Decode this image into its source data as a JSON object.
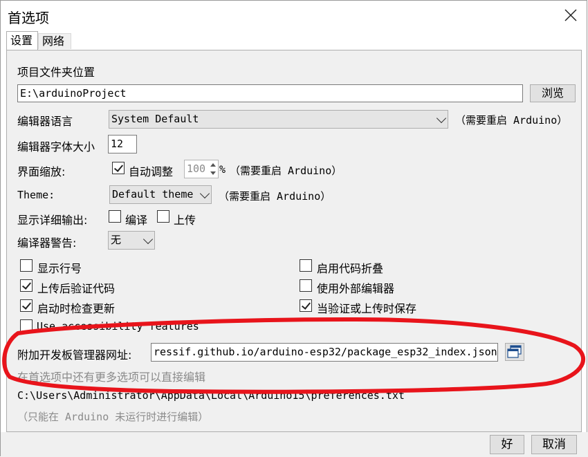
{
  "window": {
    "title": "首选项"
  },
  "tabs": [
    {
      "label": "设置"
    },
    {
      "label": "网络"
    }
  ],
  "sketchbook": {
    "label": "项目文件夹位置",
    "value": "E:\\arduinoProject",
    "browse": "浏览"
  },
  "language": {
    "label": "编辑器语言",
    "value": "System Default",
    "note": "（需要重启 Arduino）"
  },
  "font_size": {
    "label": "编辑器字体大小",
    "value": "12"
  },
  "scaling": {
    "label": "界面缩放:",
    "auto_label": "自动调整",
    "auto_checked": true,
    "value": "100",
    "unit": "%",
    "note": "（需要重启 Arduino）"
  },
  "theme": {
    "label": "Theme:",
    "value": "Default theme",
    "note": "（需要重启 Arduino）"
  },
  "verbose": {
    "label": "显示详细输出:",
    "compile": "编译",
    "upload": "上传"
  },
  "warnings": {
    "label": "编译器警告:",
    "value": "无"
  },
  "options": {
    "line_numbers": "显示行号",
    "code_folding": "启用代码折叠",
    "verify_after_upload": "上传后验证代码",
    "external_editor": "使用外部编辑器",
    "check_updates": "启动时检查更新",
    "save_on_verify": "当验证或上传时保存",
    "accessibility": "Use accessibility features"
  },
  "board_urls": {
    "label": "附加开发板管理器网址:",
    "value": "ressif.github.io/arduino-esp32/package_esp32_index.json"
  },
  "more_prefs": "在首选项中还有更多选项可以直接编辑",
  "prefs_path": "C:\\Users\\Administrator\\AppData\\Local\\Arduino15\\preferences.txt",
  "edit_note": "（只能在 Arduino 未运行时进行编辑）",
  "buttons": {
    "ok": "好",
    "cancel": "取消"
  },
  "colors": {
    "annotation_red": "#e8141b"
  }
}
